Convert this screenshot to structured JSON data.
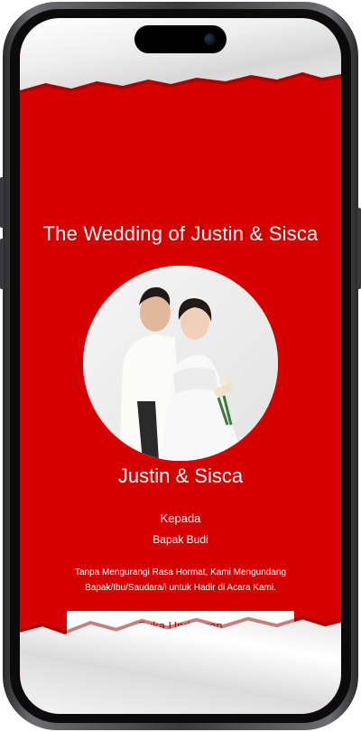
{
  "invitation": {
    "title": "The Wedding of Justin & Sisca",
    "couple_name": "Justin & Sisca",
    "to_label": "Kepada",
    "guest_name": "Bapak Budi",
    "message_line1": "Tanpa Mengurangi Rasa Hormat, Kami Mengundang",
    "message_line2": "Bapak/Ibu/Saudara/i untuk Hadir di Acara Kami.",
    "open_button_label": "Buka Undangan"
  },
  "colors": {
    "background_red": "#d50000",
    "paper": "#f0f0f0",
    "text": "#ffffff",
    "button_bg": "#ffffff",
    "button_text": "#d50000"
  }
}
